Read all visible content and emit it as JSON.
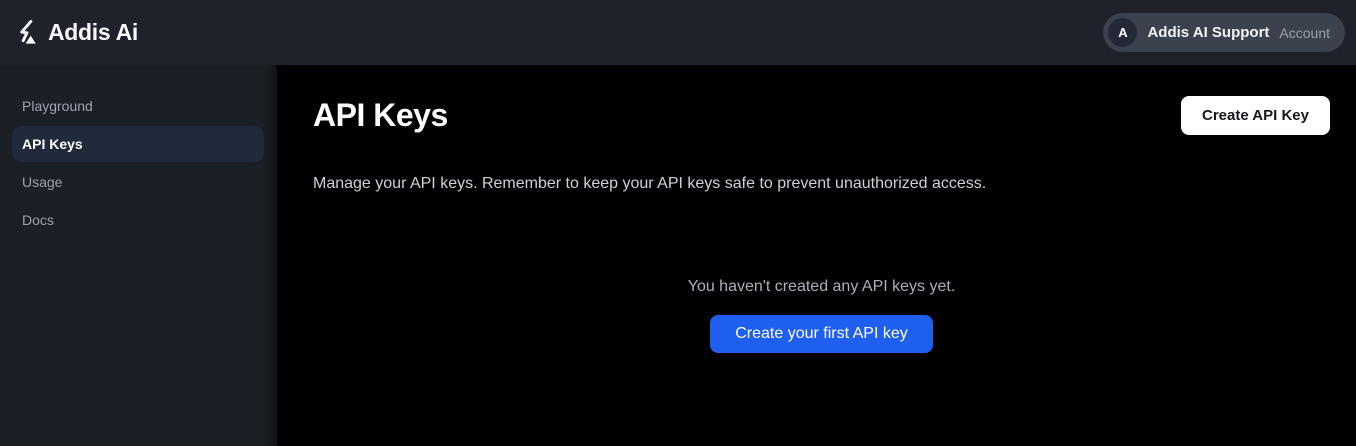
{
  "colors": {
    "header_bg": "#1f222a",
    "sidebar_bg": "#1c1f25",
    "main_bg": "#000000",
    "active_item_bg": "#202a3a",
    "pill_bg": "#3b414d",
    "avatar_bg": "#232937",
    "accent_blue": "#1e5ff0"
  },
  "header": {
    "brand": "Addis Ai",
    "logo_icon": "bolt-triangle-icon",
    "account": {
      "avatar_initial": "A",
      "name": "Addis AI Support",
      "role": "Account"
    }
  },
  "sidebar": {
    "items": [
      {
        "label": "Playground",
        "active": false
      },
      {
        "label": "API Keys",
        "active": true
      },
      {
        "label": "Usage",
        "active": false
      },
      {
        "label": "Docs",
        "active": false
      }
    ]
  },
  "main": {
    "title": "API Keys",
    "create_button_label": "Create API Key",
    "description": "Manage your API keys. Remember to keep your API keys safe to prevent unauthorized access.",
    "empty_state": {
      "message": "You haven't created any API keys yet.",
      "cta_label": "Create your first API key"
    }
  }
}
